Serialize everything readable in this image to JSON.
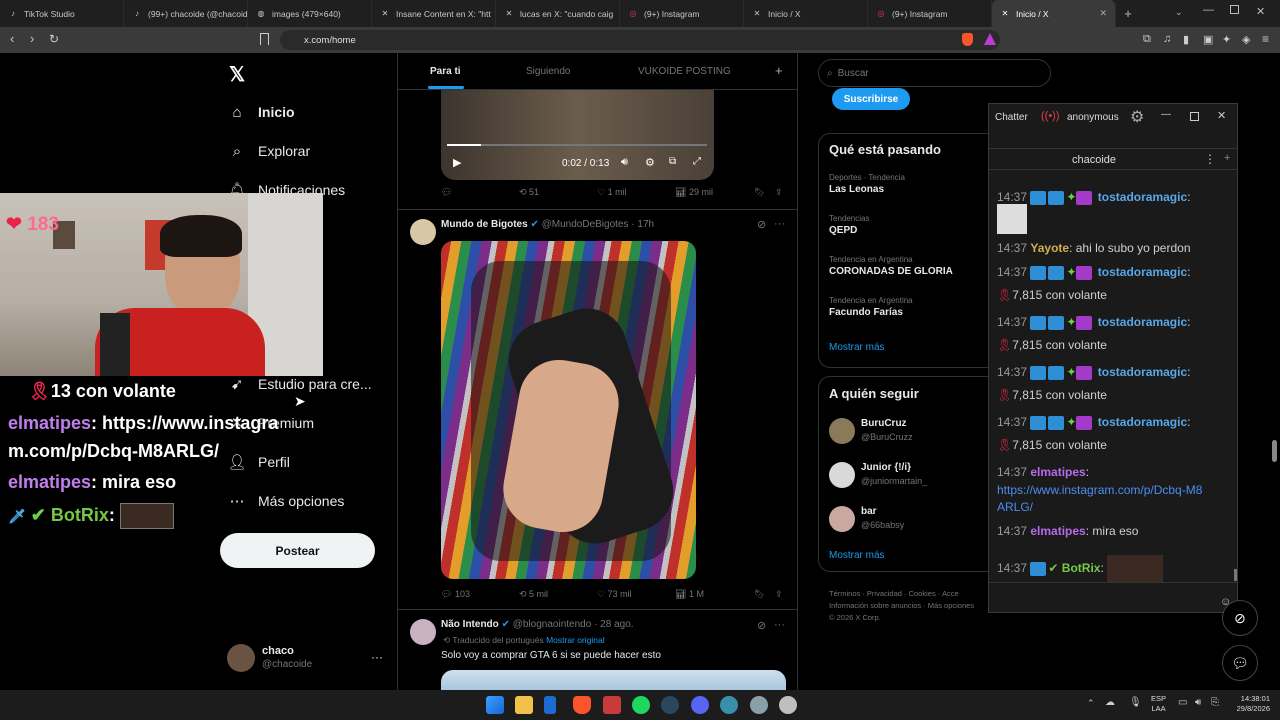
{
  "browser": {
    "tabs": [
      {
        "label": "TikTok Studio",
        "fav": "♪"
      },
      {
        "label": "(99+) chacoide (@chacoid",
        "fav": "♪"
      },
      {
        "label": "images (479×640)",
        "fav": "◍"
      },
      {
        "label": "Insane Content en X: \"htt",
        "fav": "✕"
      },
      {
        "label": "lucas en X: \"cuando caig",
        "fav": "✕"
      },
      {
        "label": "(9+) Instagram",
        "fav": "◎"
      },
      {
        "label": "Inicio / X",
        "fav": "✕"
      },
      {
        "label": "(9+) Instagram",
        "fav": "◎"
      },
      {
        "label": "Inicio / X",
        "fav": "✕"
      }
    ],
    "url": "x.com/home"
  },
  "nav": {
    "items": [
      {
        "label": "Inicio"
      },
      {
        "label": "Explorar"
      },
      {
        "label": "Notificaciones"
      },
      {
        "label": "Estudio para cre..."
      },
      {
        "label": "Premium"
      },
      {
        "label": "Perfil"
      },
      {
        "label": "Más opciones"
      }
    ],
    "post_button": "Postear",
    "account_name": "chaco",
    "account_handle": "@chacoide"
  },
  "feed": {
    "tabs": [
      "Para ti",
      "Siguiendo",
      "VUKOIDE POSTING"
    ],
    "video1": {
      "time": "0:02 / 0:13",
      "replies": "",
      "reposts": "51",
      "likes": "1 mil",
      "views": "29 mil"
    },
    "post2": {
      "name": "Mundo de Bigotes",
      "handle": "@MundoDeBigotes · 17h",
      "replies": "103",
      "reposts": "5 mil",
      "likes": "73 mil",
      "views": "1 M"
    },
    "post3": {
      "name": "Não Intendo",
      "handle": "@blognaointendo · 28 ago.",
      "translated": "Traducido del portugués",
      "show_original": "Mostrar original",
      "text": "Solo voy a comprar GTA 6 si se puede hacer esto"
    }
  },
  "sidebar": {
    "search_placeholder": "Buscar",
    "subscribe": "Suscribirse",
    "trends_title": "Qué está pasando",
    "trends": [
      {
        "context": "Deportes · Tendencia",
        "name": "Las Leonas"
      },
      {
        "context": "Tendencias",
        "name": "QEPD"
      },
      {
        "context": "Tendencia en Argentina",
        "name": "CORONADAS DE GLORIA"
      },
      {
        "context": "Tendencia en Argentina",
        "name": "Facundo Farías"
      }
    ],
    "show_more": "Mostrar más",
    "follow_title": "A quién seguir",
    "follow": [
      {
        "name": "BuruCruz",
        "handle": "@BuruCruzz"
      },
      {
        "name": "Junior {!/i}",
        "handle": "@juniormartain_"
      },
      {
        "name": "bar",
        "handle": "@66babsy"
      }
    ],
    "show_more2": "Mostrar más",
    "footer1": "Términos · Privacidad · Cookies · Acce",
    "footer2": "Información sobre anuncios · Más opciones",
    "footer3": "© 2026 X Corp."
  },
  "chatterino": {
    "app": "Chatter",
    "user": "anonymous",
    "channel": "chacoide",
    "lines": [
      {
        "t": "14:37",
        "user": "tostadoramagic",
        "msg": ":",
        "color": "#5aa7e6"
      },
      {
        "t": "14:37",
        "user": "Yayote",
        "msg": ": ahi lo subo yo perdon",
        "color": "#d2b04c"
      },
      {
        "t": "14:37",
        "user": "tostadoramagic",
        "msg": ":",
        "color": "#5aa7e6"
      },
      {
        "t": "",
        "user": "",
        "msg": "7,815 con volante",
        "color": "#d0d0d0"
      },
      {
        "t": "14:37",
        "user": "tostadoramagic",
        "msg": ":",
        "color": "#5aa7e6"
      },
      {
        "t": "",
        "user": "",
        "msg": "7,815 con volante",
        "color": "#d0d0d0"
      },
      {
        "t": "14:37",
        "user": "tostadoramagic",
        "msg": ":",
        "color": "#5aa7e6"
      },
      {
        "t": "",
        "user": "",
        "msg": "7,815 con volante",
        "color": "#d0d0d0"
      },
      {
        "t": "14:37",
        "user": "tostadoramagic",
        "msg": ":",
        "color": "#5aa7e6"
      },
      {
        "t": "",
        "user": "",
        "msg": "7,815 con volante",
        "color": "#d0d0d0"
      },
      {
        "t": "14:37",
        "user": "elmatipes",
        "msg": ":",
        "color": "#b76be8"
      },
      {
        "t": "",
        "user": "",
        "msg": "https://www.instagram.com/p/Dcbq-M8",
        "color": "#4a8ff0"
      },
      {
        "t": "",
        "user": "",
        "msg": "ARLG/",
        "color": "#4a8ff0"
      },
      {
        "t": "14:37",
        "user": "elmatipes",
        "msg": ": mira eso",
        "color": "#b76be8"
      },
      {
        "t": "14:37",
        "user": "BotRix",
        "msg": ":",
        "color": "#74c944"
      }
    ]
  },
  "overlay": {
    "hearts": "183",
    "l1": "13 con volante",
    "l2_user": "elmatipes",
    "l2_msg": ": https://www.instagra",
    "l3": "m.com/p/Dcbq-M8ARLG/",
    "l4_user": "elmatipes",
    "l4_msg": ": mira eso",
    "l5_user": "BotRix",
    "l5_msg": ":"
  },
  "taskbar": {
    "lang1": "ESP",
    "lang2": "LAA",
    "time": "14:38:01",
    "date": "29/8/2026"
  }
}
